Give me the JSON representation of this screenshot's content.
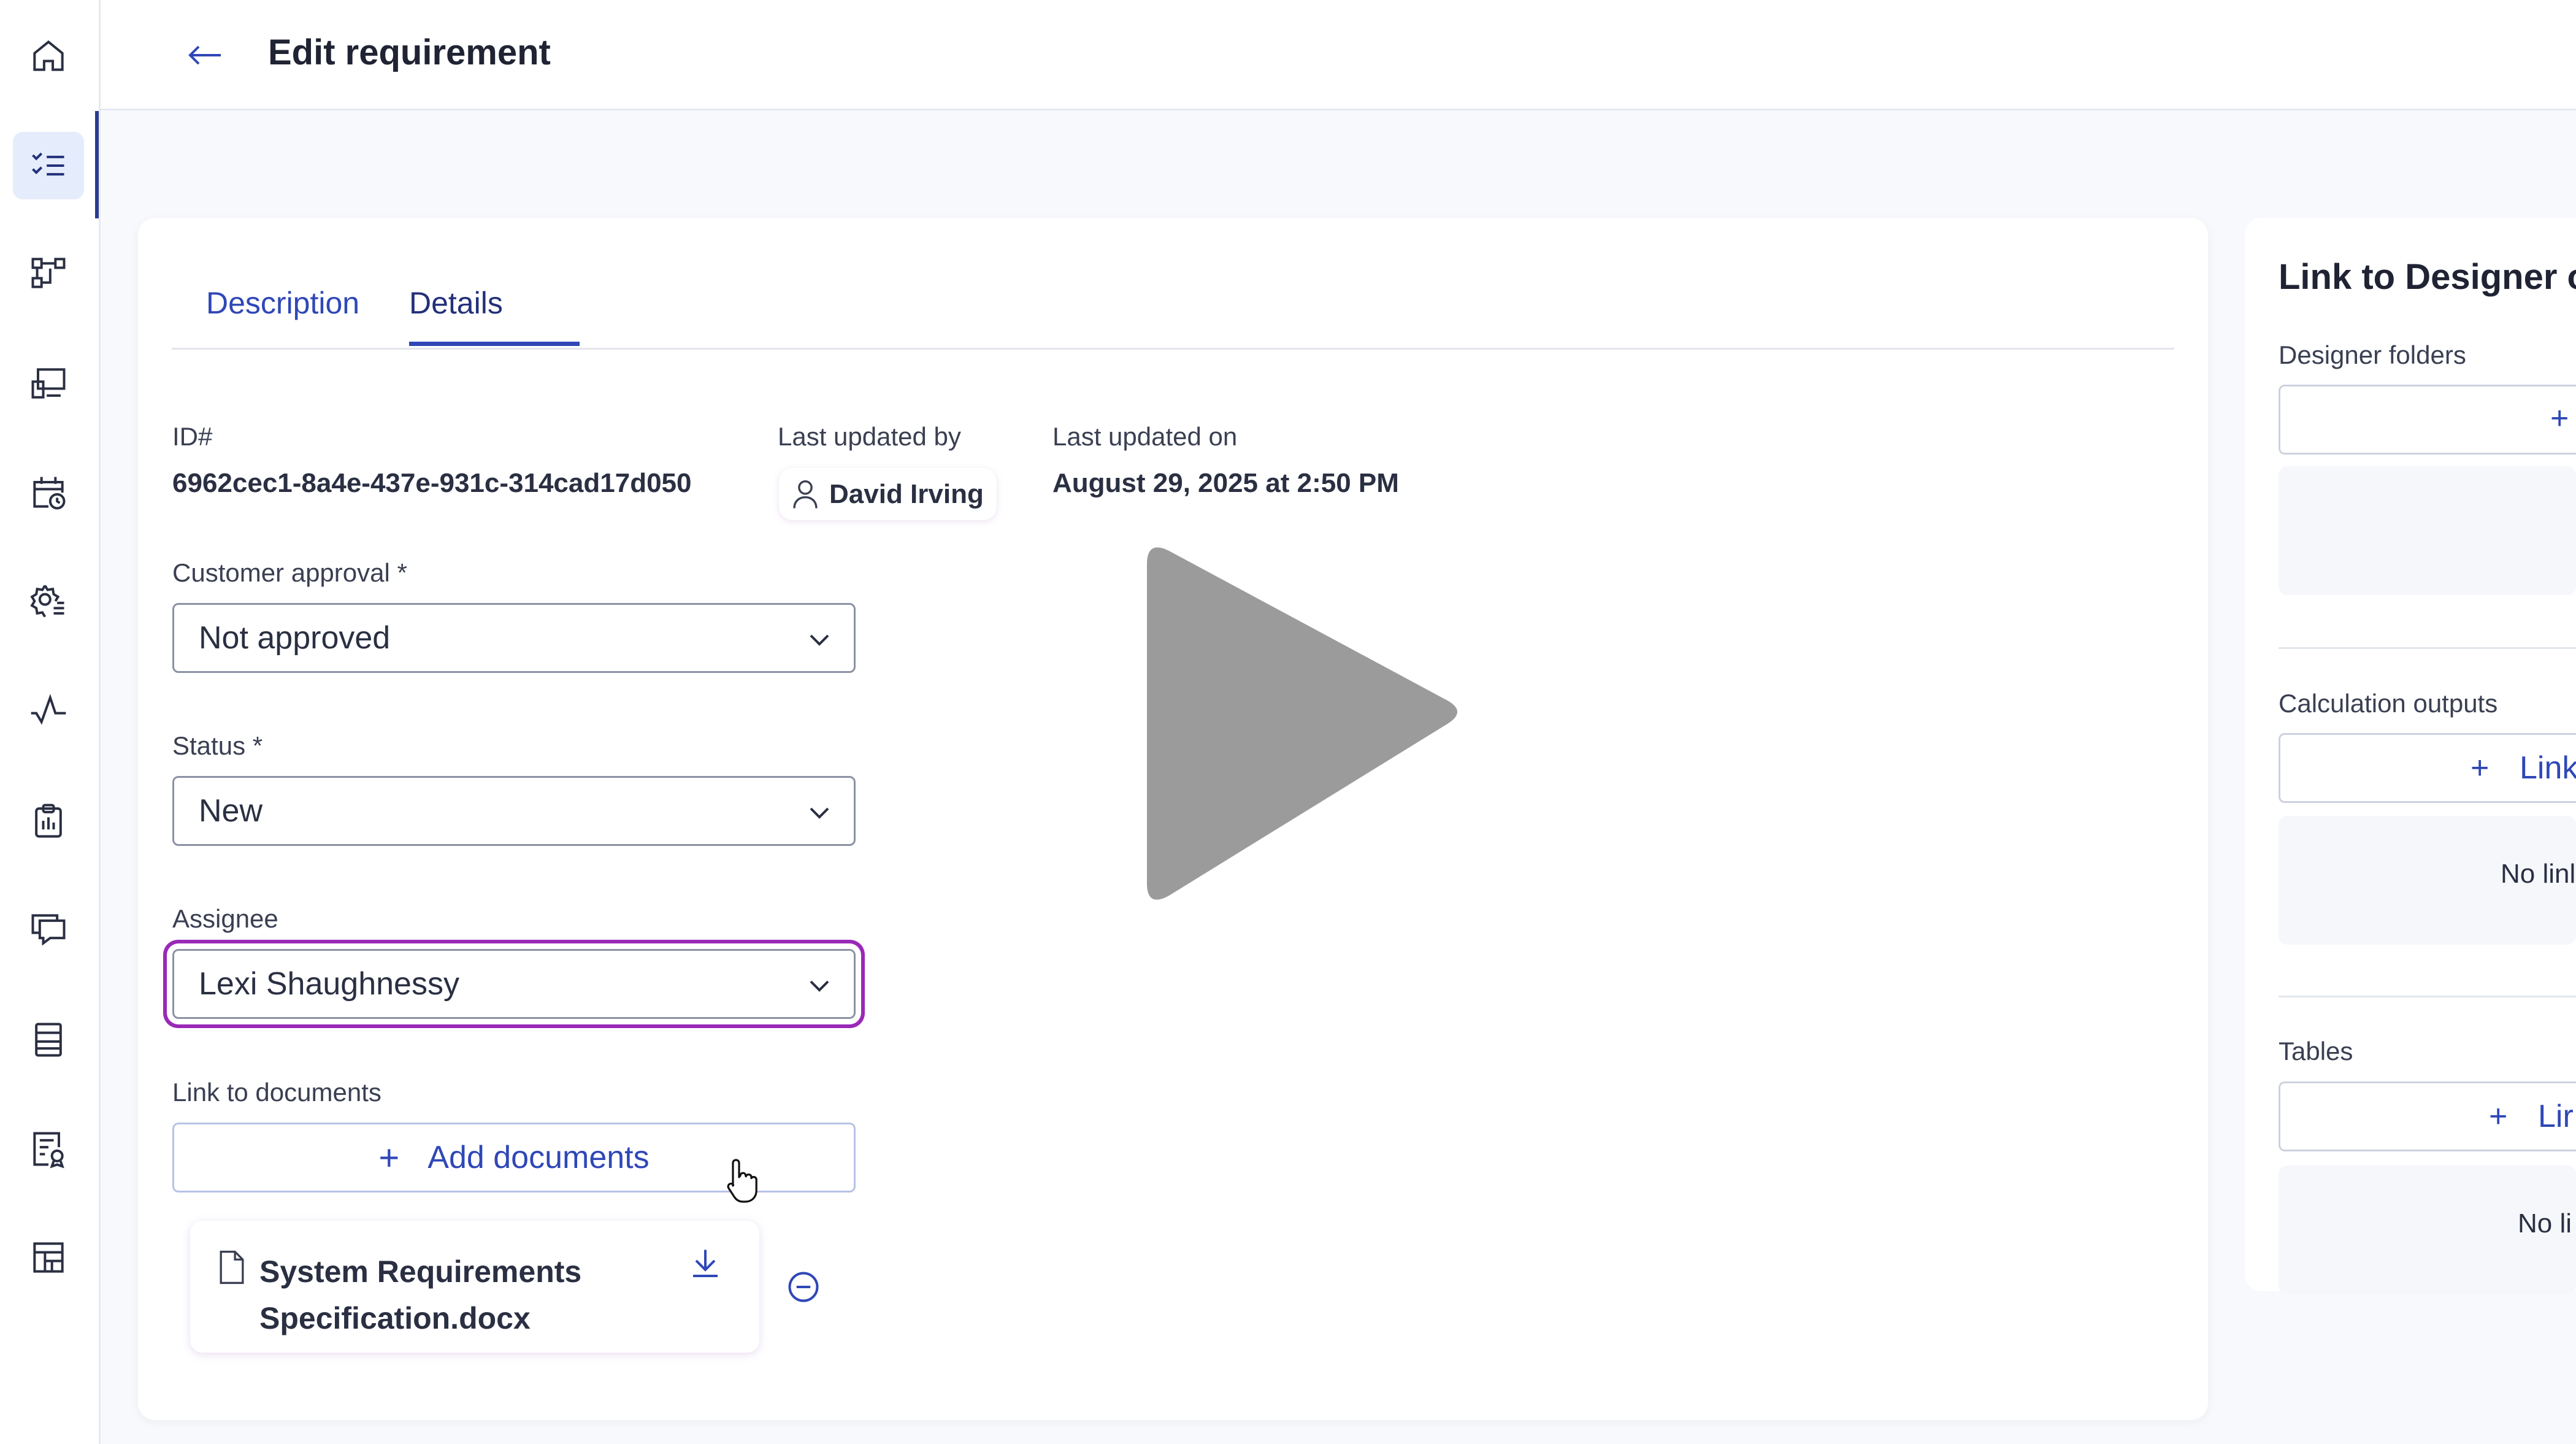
{
  "header": {
    "title": "Edit requirement"
  },
  "tabs": [
    {
      "label": "Description"
    },
    {
      "label": "Details"
    }
  ],
  "details": {
    "id_label": "ID#",
    "id_value": "6962cec1-8a4e-437e-931c-314cad17d050",
    "last_updated_by_label": "Last updated by",
    "last_updated_by_value": "David Irving",
    "last_updated_on_label": "Last updated on",
    "last_updated_on_value": "August 29, 2025 at 2:50 PM",
    "customer_approval_label": "Customer approval *",
    "customer_approval_value": "Not approved",
    "status_label": "Status *",
    "status_value": "New",
    "assignee_label": "Assignee",
    "assignee_value": "Lexi Shaughnessy",
    "link_docs_label": "Link to documents",
    "add_docs_button": "Add documents",
    "document_name": "System Requirements Specification.docx"
  },
  "right_panel": {
    "title": "Link to Designer o",
    "designer_folders_label": "Designer folders",
    "designer_folders_button": "+",
    "calc_outputs_label": "Calculation outputs",
    "calc_outputs_button": "Link",
    "calc_outputs_empty": "No linl",
    "tables_label": "Tables",
    "tables_button": "Lir",
    "tables_empty": "No li"
  },
  "icons": {
    "rail": [
      "home-icon",
      "checklist-icon",
      "workflow-icon",
      "designer-icon",
      "calendar-clock-icon",
      "settings-list-icon",
      "activity-icon",
      "clipboard-icon",
      "comments-icon",
      "table-icon",
      "report-icon",
      "dashboard-icon"
    ],
    "overlay": "play-icon"
  },
  "colors": {
    "accent": "#2f47b7",
    "focus": "#9a28b8",
    "rail_active": "#e5ecfb"
  }
}
